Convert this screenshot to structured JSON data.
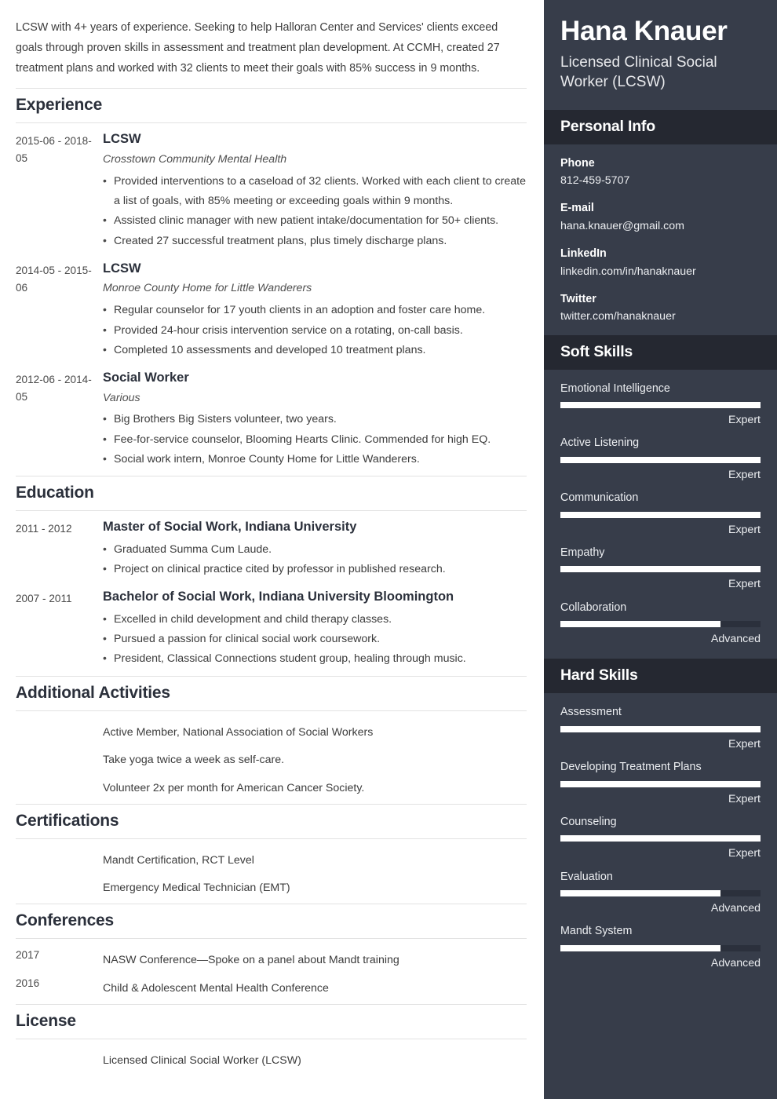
{
  "main": {
    "summary": "LCSW with 4+ years of experience. Seeking to help Halloran Center and Services' clients exceed goals through proven skills in assessment and treatment plan development. At CCMH, created 27 treatment plans and worked with 32 clients to meet their goals with 85% success in 9 months.",
    "sections": {
      "experience": {
        "title": "Experience",
        "entries": [
          {
            "date": "2015-06 - 2018-05",
            "title": "LCSW",
            "subtitle": "Crosstown Community Mental Health",
            "bullets": [
              "Provided interventions to a caseload of 32 clients. Worked with each client to create a list of goals, with 85% meeting or exceeding goals within 9 months.",
              "Assisted clinic manager with new patient intake/documentation for 50+ clients.",
              "Created 27 successful treatment plans, plus timely discharge plans."
            ]
          },
          {
            "date": "2014-05 - 2015-06",
            "title": "LCSW",
            "subtitle": "Monroe County Home for Little Wanderers",
            "bullets": [
              "Regular counselor for 17 youth clients in an adoption and foster care home.",
              "Provided 24-hour crisis intervention service on a rotating, on-call basis.",
              "Completed 10 assessments and developed 10 treatment plans."
            ]
          },
          {
            "date": "2012-06 - 2014-05",
            "title": "Social Worker",
            "subtitle": "Various",
            "bullets": [
              "Big Brothers Big Sisters volunteer, two years.",
              "Fee-for-service counselor, Blooming Hearts Clinic. Commended for high EQ.",
              "Social work intern, Monroe County Home for Little Wanderers."
            ]
          }
        ]
      },
      "education": {
        "title": "Education",
        "entries": [
          {
            "date": "2011 - 2012",
            "title": "Master of Social Work, Indiana University",
            "bullets": [
              "Graduated Summa Cum Laude.",
              "Project on clinical practice cited by professor in published research."
            ]
          },
          {
            "date": "2007 - 2011",
            "title": "Bachelor of Social Work, Indiana University Bloomington",
            "bullets": [
              "Excelled in child development and child therapy classes.",
              "Pursued a passion for clinical social work coursework.",
              "President, Classical Connections student group, healing through music."
            ]
          }
        ]
      },
      "additional_activities": {
        "title": "Additional Activities",
        "items": [
          {
            "date": "",
            "text": "Active Member, National Association of Social Workers"
          },
          {
            "date": "",
            "text": "Take yoga twice a week as self-care."
          },
          {
            "date": "",
            "text": "Volunteer 2x per month for American Cancer Society."
          }
        ]
      },
      "certifications": {
        "title": "Certifications",
        "items": [
          {
            "date": "",
            "text": "Mandt Certification, RCT Level"
          },
          {
            "date": "",
            "text": "Emergency Medical Technician (EMT)"
          }
        ]
      },
      "conferences": {
        "title": "Conferences",
        "items": [
          {
            "date": "2017",
            "text": "NASW Conference—Spoke on a panel about Mandt training"
          },
          {
            "date": "2016",
            "text": "Child & Adolescent Mental Health Conference"
          }
        ]
      },
      "license": {
        "title": "License",
        "items": [
          {
            "date": "",
            "text": "Licensed Clinical Social Worker (LCSW)"
          }
        ]
      }
    }
  },
  "sidebar": {
    "name": "Hana Knauer",
    "job_title": "Licensed Clinical Social Worker (LCSW)",
    "personal_info": {
      "title": "Personal Info",
      "items": [
        {
          "label": "Phone",
          "value": "812-459-5707"
        },
        {
          "label": "E-mail",
          "value": "hana.knauer@gmail.com"
        },
        {
          "label": "LinkedIn",
          "value": "linkedin.com/in/hanaknauer"
        },
        {
          "label": "Twitter",
          "value": "twitter.com/hanaknauer"
        }
      ]
    },
    "soft_skills": {
      "title": "Soft Skills",
      "items": [
        {
          "name": "Emotional Intelligence",
          "level": "Expert",
          "percent": 100
        },
        {
          "name": "Active Listening",
          "level": "Expert",
          "percent": 100
        },
        {
          "name": "Communication",
          "level": "Expert",
          "percent": 100
        },
        {
          "name": "Empathy",
          "level": "Expert",
          "percent": 100
        },
        {
          "name": "Collaboration",
          "level": "Advanced",
          "percent": 80
        }
      ]
    },
    "hard_skills": {
      "title": "Hard Skills",
      "items": [
        {
          "name": "Assessment",
          "level": "Expert",
          "percent": 100
        },
        {
          "name": "Developing Treatment Plans",
          "level": "Expert",
          "percent": 100
        },
        {
          "name": "Counseling",
          "level": "Expert",
          "percent": 100
        },
        {
          "name": "Evaluation",
          "level": "Advanced",
          "percent": 80
        },
        {
          "name": "Mandt System",
          "level": "Advanced",
          "percent": 80
        }
      ]
    }
  },
  "colors": {
    "sidebar_bg": "#373d4a",
    "sidebar_header_bg": "#252831",
    "bar_fill": "#ffffff",
    "bar_track": "#2b303c",
    "heading_text": "#2b303b",
    "body_text": "#3c3c3c",
    "rule": "#e2e2e2"
  }
}
